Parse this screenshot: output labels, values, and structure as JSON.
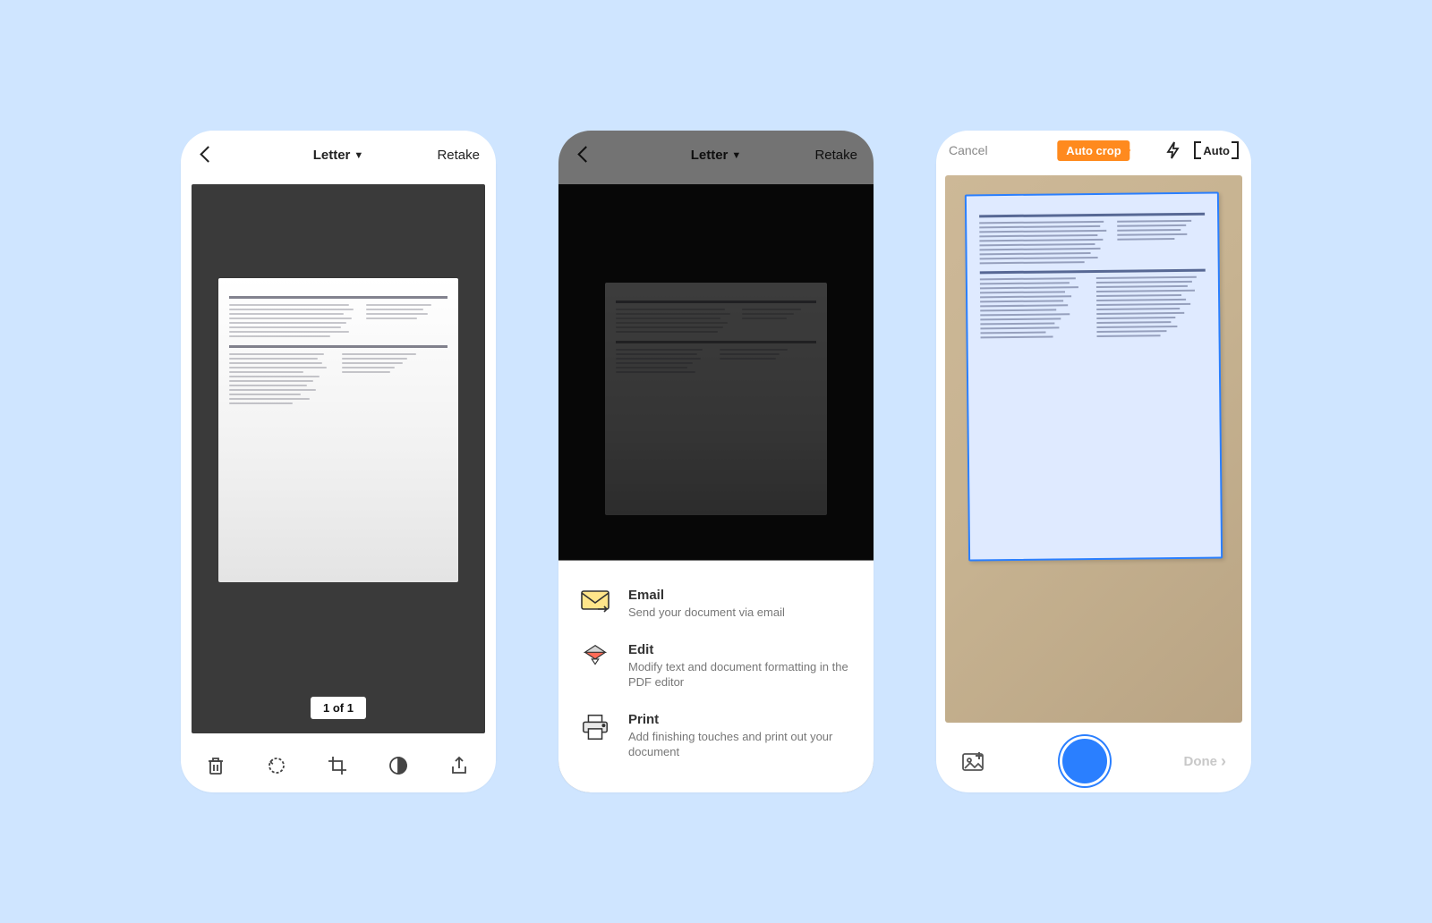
{
  "phone1": {
    "paper_size": "Letter",
    "retake": "Retake",
    "counter": "1 of 1",
    "tools": {
      "delete": "delete",
      "rotate": "rotate",
      "crop": "crop",
      "filter": "filter",
      "share": "share"
    }
  },
  "phone2": {
    "paper_size": "Letter",
    "retake": "Retake",
    "options": [
      {
        "icon": "email",
        "title": "Email",
        "desc": "Send your document via email"
      },
      {
        "icon": "edit",
        "title": "Edit",
        "desc": "Modify text and document formatting in the PDF editor"
      },
      {
        "icon": "print",
        "title": "Print",
        "desc": "Add finishing touches and print out your document"
      }
    ]
  },
  "phone3": {
    "cancel": "Cancel",
    "autocrop": "Auto crop",
    "flash_mode": "Auto",
    "done": "Done"
  }
}
